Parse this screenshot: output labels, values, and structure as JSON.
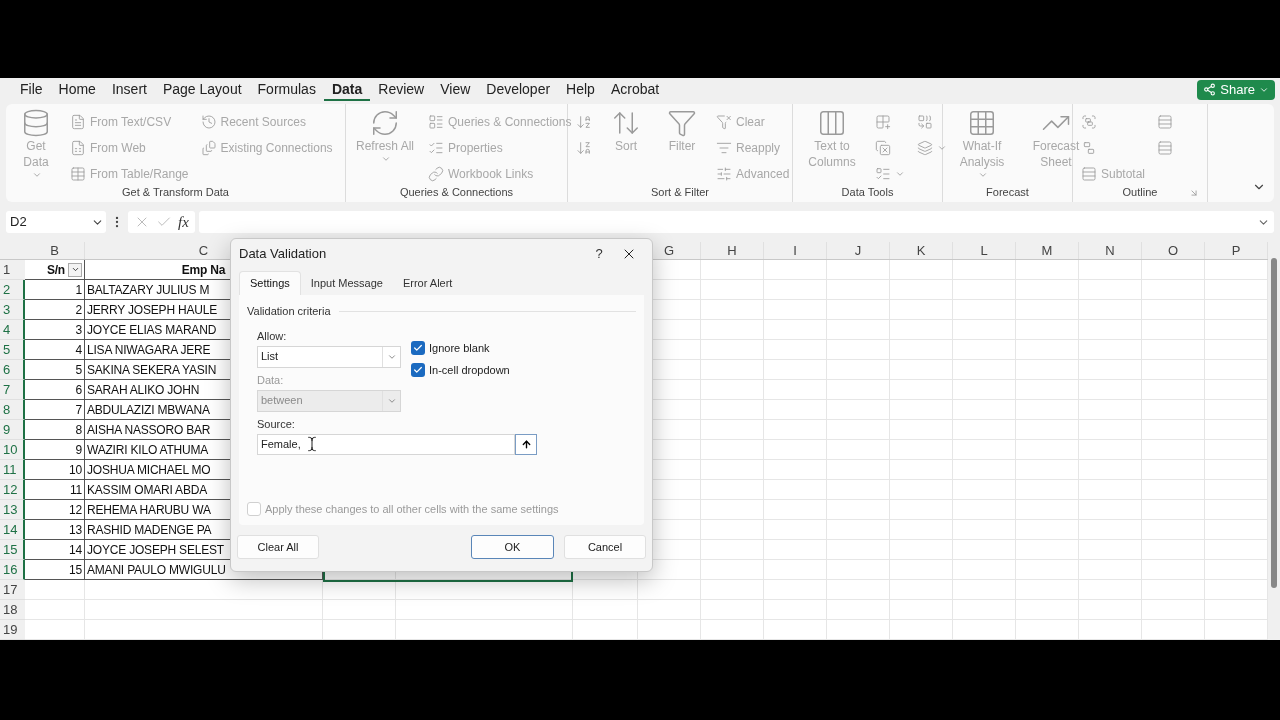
{
  "menu_tabs": [
    {
      "label": "File",
      "selected": false
    },
    {
      "label": "Home",
      "selected": false
    },
    {
      "label": "Insert",
      "selected": false
    },
    {
      "label": "Page Layout",
      "selected": false
    },
    {
      "label": "Formulas",
      "selected": false
    },
    {
      "label": "Data",
      "selected": true
    },
    {
      "label": "Review",
      "selected": false
    },
    {
      "label": "View",
      "selected": false
    },
    {
      "label": "Developer",
      "selected": false
    },
    {
      "label": "Help",
      "selected": false
    },
    {
      "label": "Acrobat",
      "selected": false
    }
  ],
  "share_button": {
    "label": "Share"
  },
  "ribbon": {
    "groups": [
      {
        "label": "Get & Transform Data",
        "launcher": false,
        "columns": [
          {
            "kind": "large",
            "label": "Get Data",
            "dropdown": true
          },
          {
            "kind": "stack",
            "items": [
              {
                "label": "From Text/CSV",
                "dropdown": false
              },
              {
                "label": "From Web",
                "dropdown": false
              },
              {
                "label": "From Table/Range",
                "dropdown": false
              }
            ]
          },
          {
            "kind": "stack",
            "items": [
              {
                "label": "Recent Sources",
                "dropdown": false
              },
              {
                "label": "Existing Connections",
                "dropdown": false
              }
            ]
          }
        ]
      },
      {
        "label": "Queries & Connections",
        "launcher": false,
        "columns": [
          {
            "kind": "large",
            "label": "Refresh All",
            "dropdown": true
          },
          {
            "kind": "stack",
            "items": [
              {
                "label": "Queries & Connections",
                "dropdown": false
              },
              {
                "label": "Properties",
                "dropdown": false
              },
              {
                "label": "Workbook Links",
                "dropdown": false
              }
            ]
          }
        ]
      },
      {
        "label": "Sort & Filter",
        "launcher": false,
        "columns": [
          {
            "kind": "stack",
            "items": [
              {
                "dropdown": false
              },
              {
                "dropdown": false
              }
            ]
          },
          {
            "kind": "large",
            "label": "Sort",
            "dropdown": false
          },
          {
            "kind": "large",
            "label": "Filter",
            "dropdown": false
          },
          {
            "kind": "stack",
            "items": [
              {
                "label": "Clear",
                "dropdown": false
              },
              {
                "label": "Reapply",
                "dropdown": false
              },
              {
                "label": "Advanced",
                "dropdown": false
              }
            ]
          }
        ]
      },
      {
        "label": "Data Tools",
        "launcher": false,
        "columns": [
          {
            "kind": "large",
            "label": "Text to Columns",
            "dropdown": false
          },
          {
            "kind": "stack",
            "items": [
              {
                "dropdown": false
              },
              {
                "dropdown": false
              },
              {
                "dropdown": true
              }
            ]
          },
          {
            "kind": "stack",
            "items": [
              {
                "dropdown": false
              },
              {
                "dropdown": true
              }
            ]
          }
        ]
      },
      {
        "label": "Forecast",
        "launcher": false,
        "columns": [
          {
            "kind": "large",
            "label": "What-If Analysis",
            "dropdown": true
          },
          {
            "kind": "large",
            "label": "Forecast Sheet",
            "dropdown": false
          }
        ]
      },
      {
        "label": "Outline",
        "launcher": true,
        "columns": [
          {
            "kind": "stack",
            "items": [
              {
                "dropdown": false
              },
              {
                "dropdown": false
              },
              {
                "label": "Subtotal",
                "dropdown": false
              }
            ]
          },
          {
            "kind": "stack",
            "items": [
              {
                "dropdown": false
              },
              {
                "dropdown": false
              }
            ]
          }
        ]
      }
    ]
  },
  "formula_bar": {
    "name_box": "D2",
    "function_label": "fx"
  },
  "column_headers": [
    "B",
    "C",
    "G",
    "H",
    "I",
    "J",
    "K",
    "L",
    "M",
    "N",
    "O",
    "P"
  ],
  "rows": [
    {
      "number": "1",
      "selected": false,
      "sn": "S/n",
      "name": "Emp Na",
      "header": true
    },
    {
      "number": "2",
      "selected": true,
      "sn": "1",
      "name": "BALTAZARY JULIUS M",
      "header": false
    },
    {
      "number": "3",
      "selected": true,
      "sn": "2",
      "name": "JERRY JOSEPH HAULE",
      "header": false
    },
    {
      "number": "4",
      "selected": true,
      "sn": "3",
      "name": "JOYCE ELIAS MARAND",
      "header": false
    },
    {
      "number": "5",
      "selected": true,
      "sn": "4",
      "name": "LISA NIWAGARA JERE",
      "header": false
    },
    {
      "number": "6",
      "selected": true,
      "sn": "5",
      "name": "SAKINA SEKERA YASIN",
      "header": false
    },
    {
      "number": "7",
      "selected": true,
      "sn": "6",
      "name": "SARAH ALIKO JOHN",
      "header": false
    },
    {
      "number": "8",
      "selected": true,
      "sn": "7",
      "name": "ABDULAZIZI MBWANA",
      "header": false
    },
    {
      "number": "9",
      "selected": true,
      "sn": "8",
      "name": "AISHA NASSORO BAR",
      "header": false
    },
    {
      "number": "10",
      "selected": true,
      "sn": "9",
      "name": "WAZIRI KILO ATHUMA",
      "header": false
    },
    {
      "number": "11",
      "selected": true,
      "sn": "10",
      "name": "JOSHUA MICHAEL MO",
      "header": false
    },
    {
      "number": "12",
      "selected": true,
      "sn": "11",
      "name": "KASSIM OMARI ABDA",
      "header": false
    },
    {
      "number": "13",
      "selected": true,
      "sn": "12",
      "name": "REHEMA HARUBU WA",
      "header": false
    },
    {
      "number": "14",
      "selected": true,
      "sn": "13",
      "name": "RASHID MADENGE PA",
      "header": false
    },
    {
      "number": "15",
      "selected": true,
      "sn": "14",
      "name": "JOYCE JOSEPH SELEST",
      "header": false
    },
    {
      "number": "16",
      "selected": true,
      "sn": "15",
      "name": "AMANI PAULO MWIGULU",
      "header": false
    },
    {
      "number": "17",
      "selected": false
    },
    {
      "number": "18",
      "selected": false
    },
    {
      "number": "19",
      "selected": false
    }
  ],
  "dialog": {
    "title": "Data Validation",
    "help": "?",
    "tabs": [
      {
        "label": "Settings",
        "selected": true
      },
      {
        "label": "Input Message",
        "selected": false
      },
      {
        "label": "Error Alert",
        "selected": false
      }
    ],
    "section_title": "Validation criteria",
    "allow": {
      "label": "Allow:",
      "value": "List",
      "disabled": false
    },
    "data": {
      "label": "Data:",
      "value": "between",
      "disabled": true
    },
    "checkboxes": [
      {
        "label": "Ignore blank",
        "checked": true,
        "disabled": false
      },
      {
        "label": "In-cell dropdown",
        "checked": true,
        "disabled": false
      }
    ],
    "source": {
      "label": "Source:",
      "value": "Female,"
    },
    "apply_all": {
      "label": "Apply these changes to all other cells with the same settings",
      "checked": false,
      "disabled": true
    },
    "buttons": [
      {
        "label": "Clear All",
        "default": false
      },
      {
        "label": "OK",
        "default": true
      },
      {
        "label": "Cancel",
        "default": false
      }
    ]
  }
}
